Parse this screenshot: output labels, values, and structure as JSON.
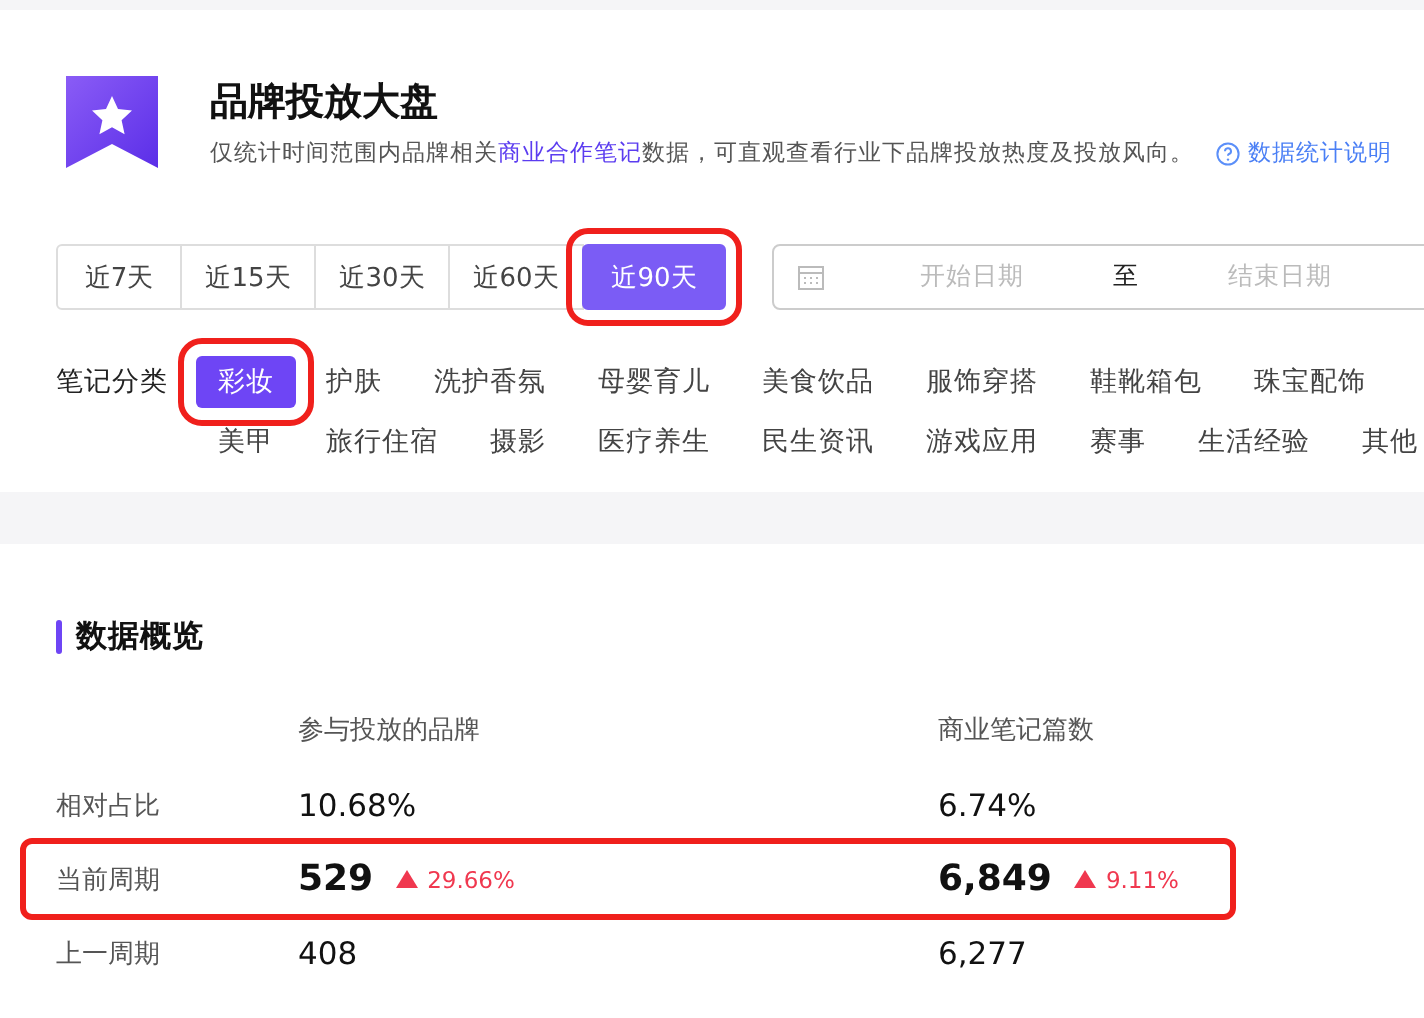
{
  "header": {
    "title": "品牌投放大盘",
    "description": "仅统计时间范围内品牌相关**商业合作笔记**数据，可直观查看行业下品牌投放热度及投放风向。",
    "help_link": "数据统计说明"
  },
  "time_tabs": [
    {
      "label": "近7天",
      "selected": false,
      "highlighted": false
    },
    {
      "label": "近15天",
      "selected": false,
      "highlighted": false
    },
    {
      "label": "近30天",
      "selected": false,
      "highlighted": false
    },
    {
      "label": "近60天",
      "selected": false,
      "highlighted": false
    },
    {
      "label": "近90天",
      "selected": true,
      "highlighted": true
    }
  ],
  "date_range": {
    "start_placeholder": "开始日期",
    "separator": "至",
    "end_placeholder": "结束日期"
  },
  "category_filter": {
    "label": "笔记分类",
    "rows": [
      [
        {
          "label": "彩妆",
          "selected": true,
          "highlighted": true
        },
        {
          "label": "护肤",
          "selected": false,
          "highlighted": false
        },
        {
          "label": "洗护香氛",
          "selected": false,
          "highlighted": false
        },
        {
          "label": "母婴育儿",
          "selected": false,
          "highlighted": false
        },
        {
          "label": "美食饮品",
          "selected": false,
          "highlighted": false
        },
        {
          "label": "服饰穿搭",
          "selected": false,
          "highlighted": false
        },
        {
          "label": "鞋靴箱包",
          "selected": false,
          "highlighted": false
        },
        {
          "label": "珠宝配饰",
          "selected": false,
          "highlighted": false
        }
      ],
      [
        {
          "label": "美甲",
          "selected": false,
          "highlighted": false
        },
        {
          "label": "旅行住宿",
          "selected": false,
          "highlighted": false
        },
        {
          "label": "摄影",
          "selected": false,
          "highlighted": false
        },
        {
          "label": "医疗养生",
          "selected": false,
          "highlighted": false
        },
        {
          "label": "民生资讯",
          "selected": false,
          "highlighted": false
        },
        {
          "label": "游戏应用",
          "selected": false,
          "highlighted": false
        },
        {
          "label": "赛事",
          "selected": false,
          "highlighted": false
        },
        {
          "label": "生活经验",
          "selected": false,
          "highlighted": false
        },
        {
          "label": "其他",
          "selected": false,
          "highlighted": false
        }
      ]
    ]
  },
  "overview": {
    "title": "数据概览",
    "columns": [
      "参与投放的品牌",
      "商业笔记篇数"
    ],
    "rows": [
      {
        "label": "相对占比",
        "emphasis": false,
        "highlighted": false,
        "cells": [
          {
            "value": "10.68%"
          },
          {
            "value": "6.74%"
          }
        ]
      },
      {
        "label": "当前周期",
        "emphasis": true,
        "highlighted": true,
        "cells": [
          {
            "value": "529",
            "change": "29.66%",
            "rising": true
          },
          {
            "value": "6,849",
            "change": "9.11%",
            "rising": true
          }
        ]
      },
      {
        "label": "上一周期",
        "emphasis": false,
        "highlighted": false,
        "cells": [
          {
            "value": "408"
          },
          {
            "value": "6,277"
          }
        ]
      }
    ]
  }
}
